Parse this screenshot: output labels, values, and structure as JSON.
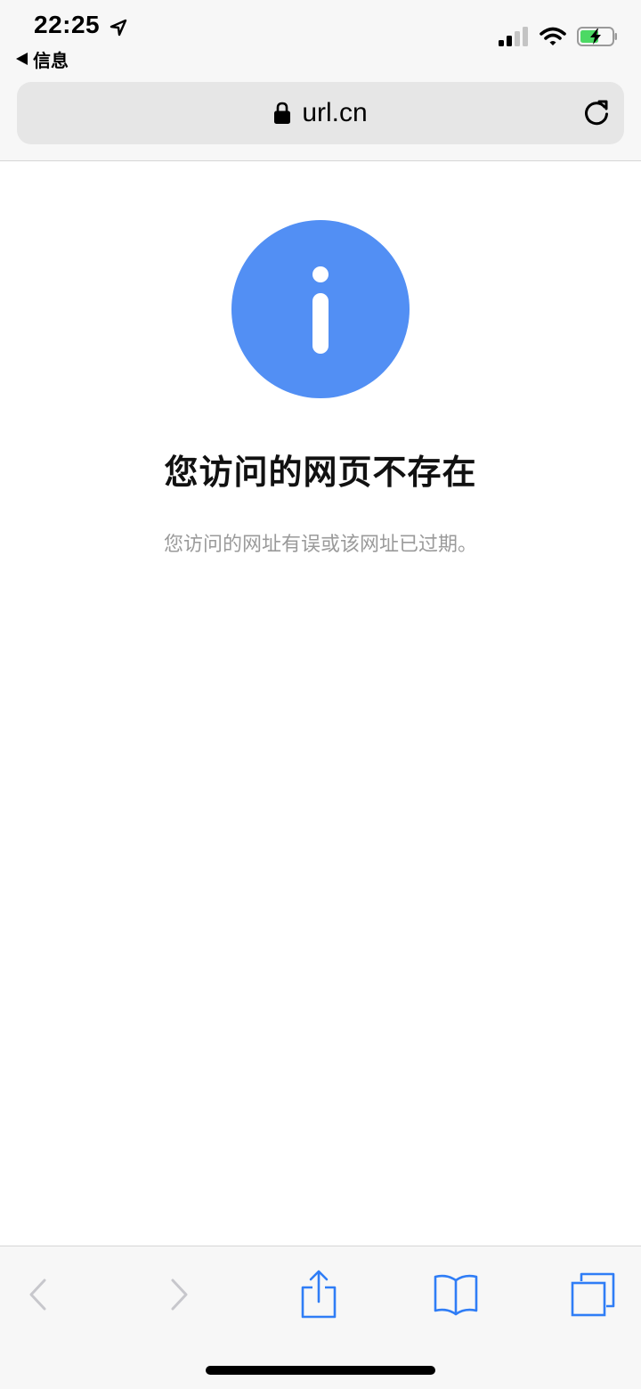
{
  "status_bar": {
    "time": "22:25",
    "back_app_label": "信息"
  },
  "address_bar": {
    "url": "url.cn"
  },
  "error_page": {
    "title": "您访问的网页不存在",
    "description": "您访问的网址有误或该网址已过期。",
    "icon_color": "#528ff4"
  },
  "toolbar": {
    "active_color": "#2f7df6",
    "disabled_color": "#c7c7cc"
  }
}
